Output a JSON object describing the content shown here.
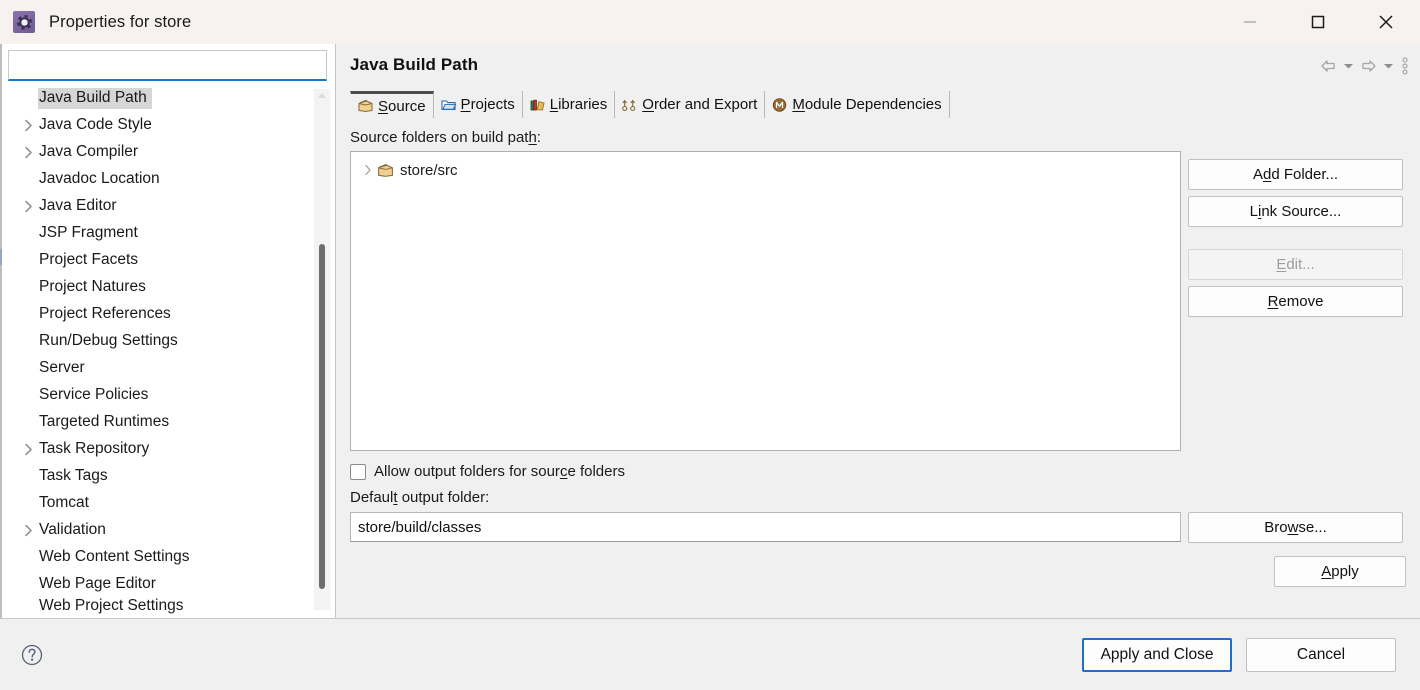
{
  "window": {
    "title": "Properties for store",
    "icon": "eclipse-gear-icon",
    "minimize_label": "—",
    "maximize_label": "□",
    "close_label": "✕"
  },
  "sidebar": {
    "filter_value": "",
    "filter_placeholder": "",
    "items": [
      {
        "label": "Java Build Path",
        "expandable": false,
        "selected": true
      },
      {
        "label": "Java Code Style",
        "expandable": true,
        "selected": false
      },
      {
        "label": "Java Compiler",
        "expandable": true,
        "selected": false
      },
      {
        "label": "Javadoc Location",
        "expandable": false,
        "selected": false
      },
      {
        "label": "Java Editor",
        "expandable": true,
        "selected": false
      },
      {
        "label": "JSP Fragment",
        "expandable": false,
        "selected": false
      },
      {
        "label": "Project Facets",
        "expandable": false,
        "selected": false
      },
      {
        "label": "Project Natures",
        "expandable": false,
        "selected": false
      },
      {
        "label": "Project References",
        "expandable": false,
        "selected": false
      },
      {
        "label": "Run/Debug Settings",
        "expandable": false,
        "selected": false
      },
      {
        "label": "Server",
        "expandable": false,
        "selected": false
      },
      {
        "label": "Service Policies",
        "expandable": false,
        "selected": false
      },
      {
        "label": "Targeted Runtimes",
        "expandable": false,
        "selected": false
      },
      {
        "label": "Task Repository",
        "expandable": true,
        "selected": false
      },
      {
        "label": "Task Tags",
        "expandable": false,
        "selected": false
      },
      {
        "label": "Tomcat",
        "expandable": false,
        "selected": false
      },
      {
        "label": "Validation",
        "expandable": true,
        "selected": false
      },
      {
        "label": "Web Content Settings",
        "expandable": false,
        "selected": false
      },
      {
        "label": "Web Page Editor",
        "expandable": false,
        "selected": false
      },
      {
        "label": "Web Project Settings",
        "expandable": false,
        "selected": false
      }
    ]
  },
  "main": {
    "page_title": "Java Build Path",
    "nav": {
      "back": "back-arrow",
      "back_menu": "chevron-down-icon",
      "forward": "forward-arrow",
      "forward_menu": "chevron-down-icon",
      "overflow": "vertical-dots-icon"
    },
    "tabs": [
      {
        "label": "Source",
        "mnemonic": "S",
        "icon": "package-icon",
        "selected": true
      },
      {
        "label": "Projects",
        "mnemonic": "P",
        "icon": "folder-icon",
        "selected": false
      },
      {
        "label": "Libraries",
        "mnemonic": "L",
        "icon": "books-icon",
        "selected": false
      },
      {
        "label": "Order and Export",
        "mnemonic": "O",
        "icon": "order-icon",
        "selected": false
      },
      {
        "label": "Module Dependencies",
        "mnemonic": "M",
        "icon": "module-icon",
        "selected": false
      }
    ],
    "source_folders_label": "Source folders on build path:",
    "source_folders_mnemonic": "h",
    "source_folders": [
      {
        "label": "store/src",
        "icon": "package-icon",
        "expandable": true
      }
    ],
    "side_buttons": [
      {
        "label": "Add Folder...",
        "mnemonic": "d",
        "enabled": true
      },
      {
        "label": "Link Source...",
        "mnemonic": "i",
        "enabled": true
      },
      {
        "label": "Edit...",
        "mnemonic": "E",
        "enabled": false
      },
      {
        "label": "Remove",
        "mnemonic": "R",
        "enabled": true
      }
    ],
    "allow_output_checkbox": {
      "label": "Allow output folders for source folders",
      "mnemonic": "c",
      "checked": false
    },
    "default_output_label": "Default output folder:",
    "default_output_mnemonic": "t",
    "default_output_value": "store/build/classes",
    "browse_label": "Browse...",
    "browse_mnemonic": "w",
    "apply_label": "Apply",
    "apply_mnemonic": "A"
  },
  "footer": {
    "help_icon": "help-circle-icon",
    "apply_and_close_label": "Apply and Close",
    "cancel_label": "Cancel"
  },
  "colors": {
    "titlebar": "#f7f2ef",
    "panel": "#f0f0f0",
    "accent": "#1976c8",
    "selection": "#d6d6d6",
    "default_button_border": "#1f6fc4"
  }
}
